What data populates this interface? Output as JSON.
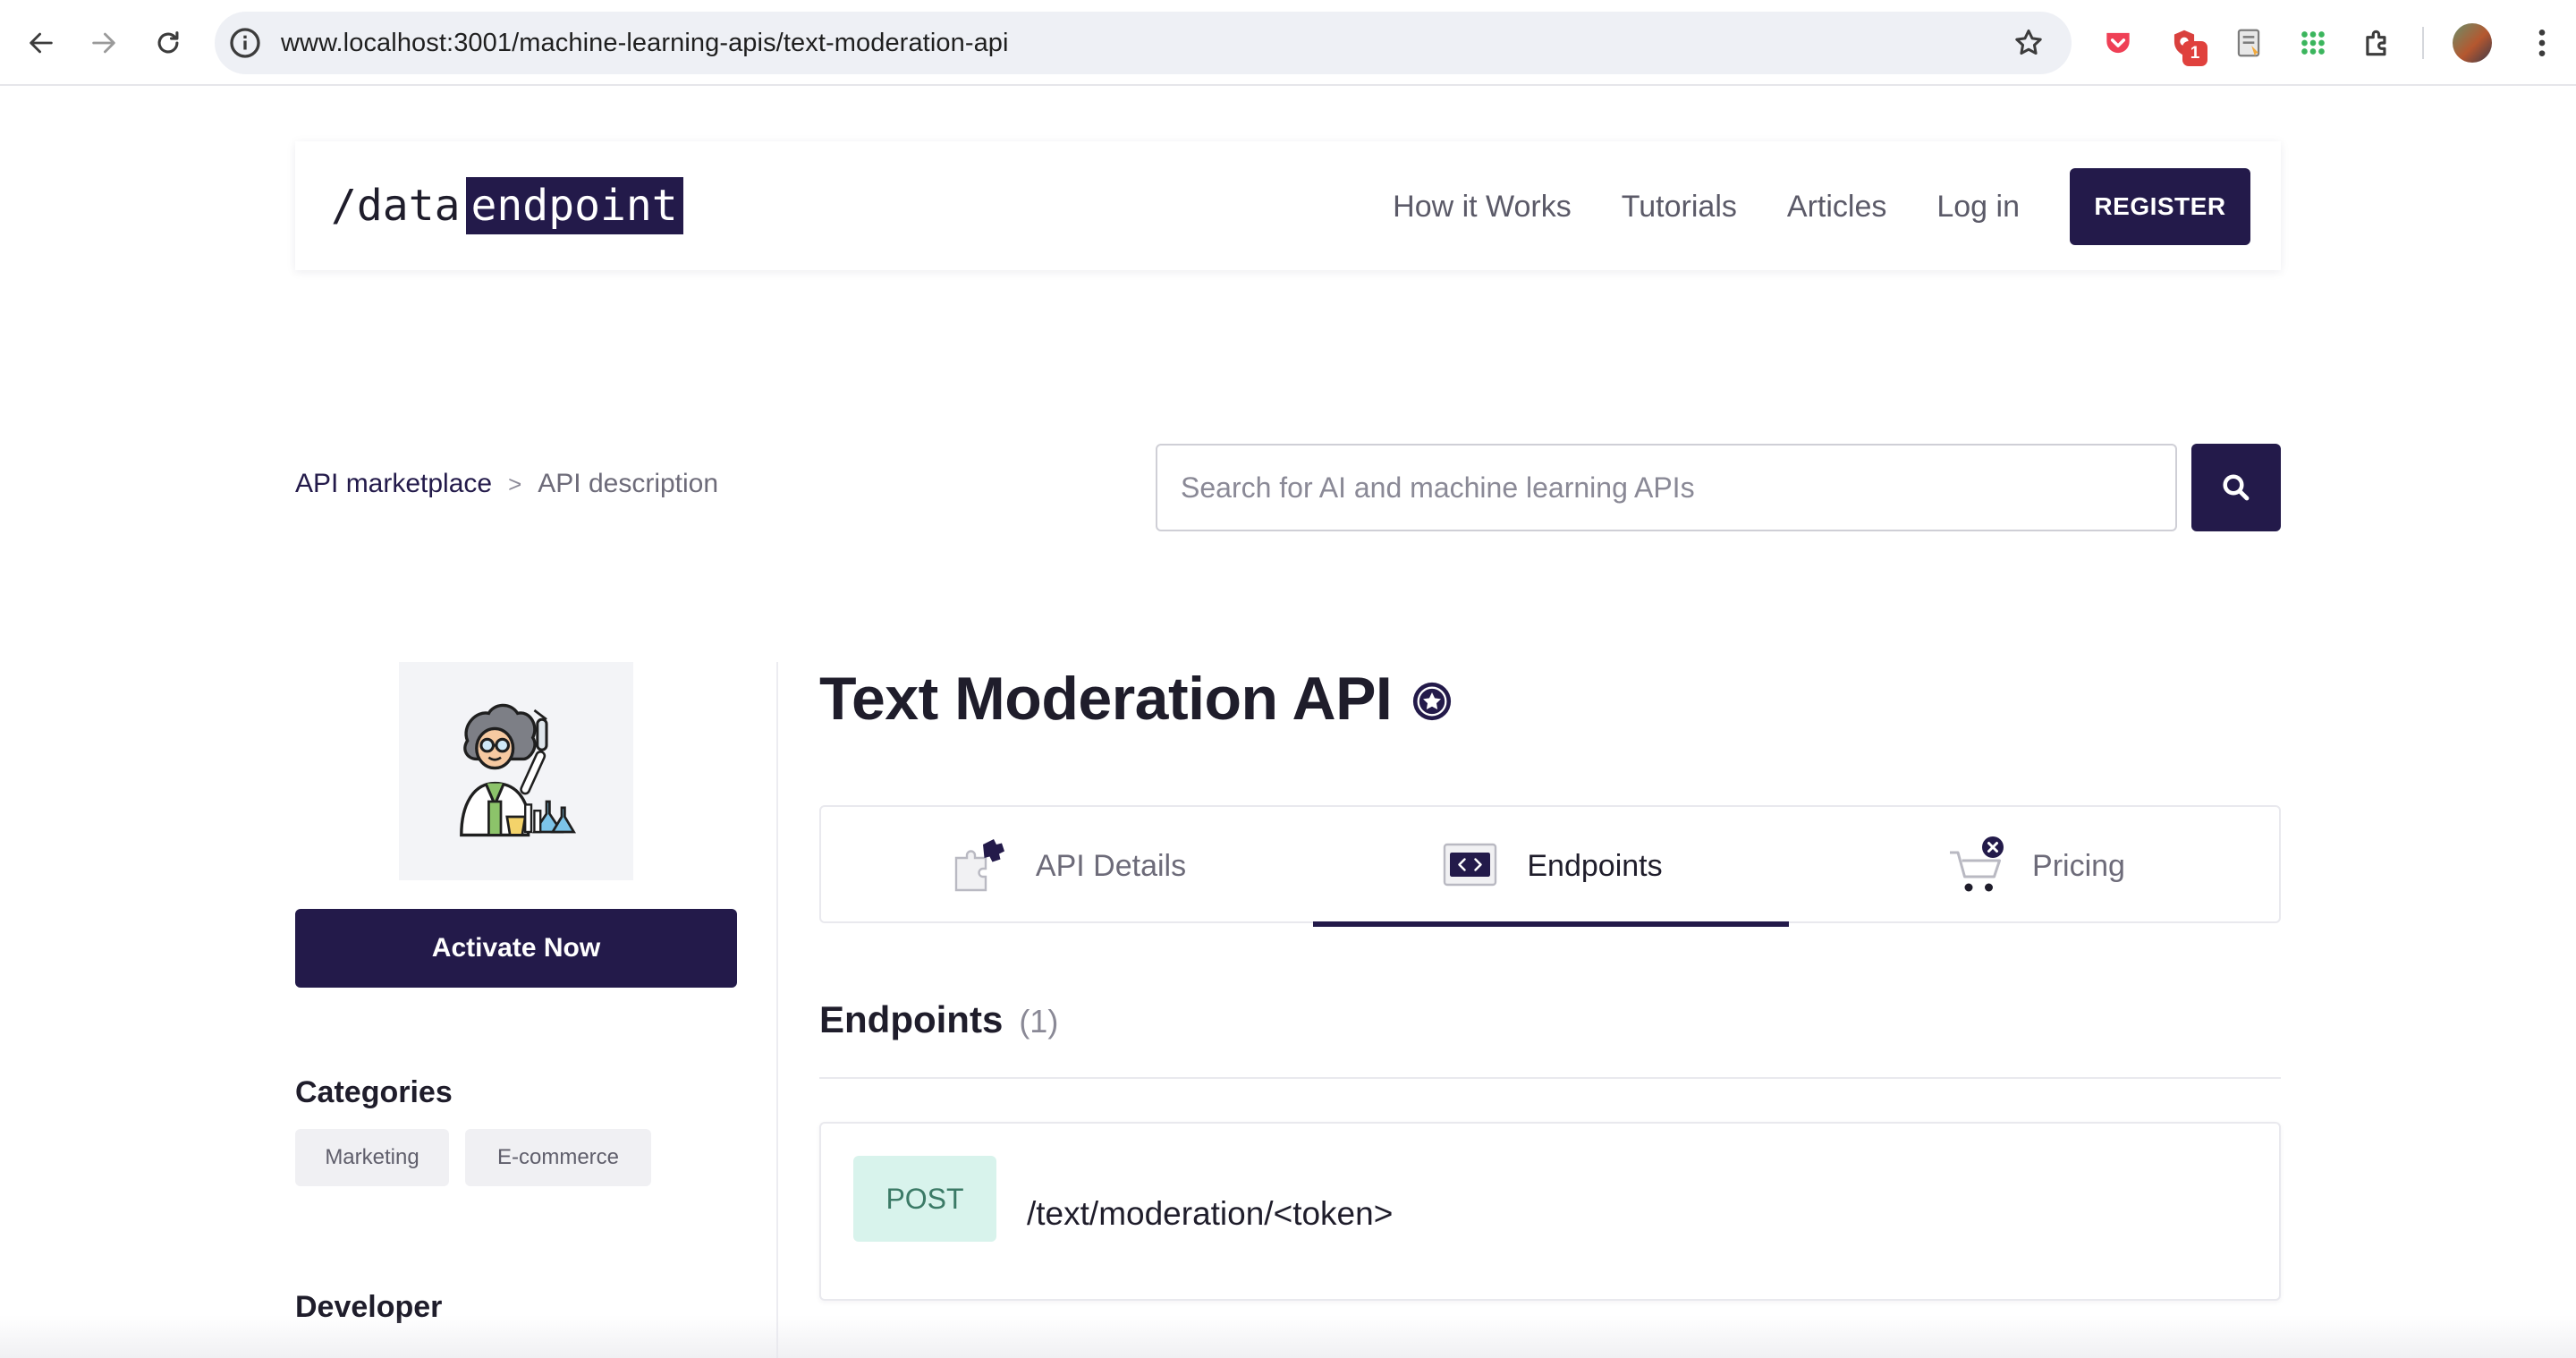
{
  "browser": {
    "url": "www.localhost:3001/machine-learning-apis/text-moderation-api",
    "extension_badge": "1"
  },
  "header": {
    "logo_prefix": "/data",
    "logo_highlight": "endpoint",
    "nav": [
      "How it Works",
      "Tutorials",
      "Articles",
      "Log in"
    ],
    "register_label": "REGISTER"
  },
  "breadcrumb": {
    "root": "API marketplace",
    "separator": ">",
    "current": "API description"
  },
  "search": {
    "placeholder": "Search for AI and machine learning APIs",
    "value": ""
  },
  "sidebar": {
    "activate_label": "Activate Now",
    "categories_heading": "Categories",
    "categories": [
      "Marketing",
      "E-commerce"
    ],
    "developer_heading": "Developer"
  },
  "api": {
    "title": "Text Moderation API"
  },
  "tabs": [
    {
      "label": "API Details",
      "icon": "puzzle-icon",
      "active": false
    },
    {
      "label": "Endpoints",
      "icon": "code-window-icon",
      "active": true
    },
    {
      "label": "Pricing",
      "icon": "cart-icon",
      "active": false
    }
  ],
  "endpoints_section": {
    "title": "Endpoints",
    "count": "(1)",
    "items": [
      {
        "method": "POST",
        "path": "/text/moderation/<token>"
      }
    ]
  },
  "colors": {
    "brand": "#231a4a",
    "method_post_bg": "#d8f3ec",
    "method_post_text": "#3b7a66"
  }
}
